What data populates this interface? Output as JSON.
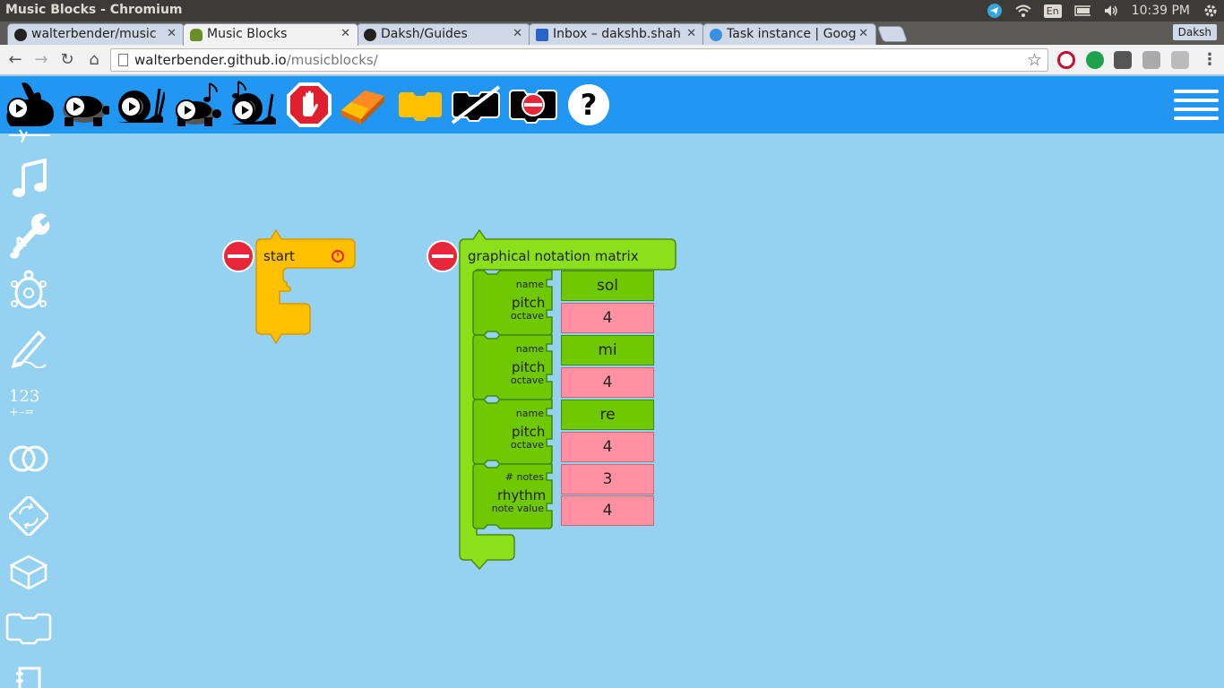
{
  "os": {
    "window_title": "Music Blocks - Chromium",
    "lang": "En",
    "time": "10:39 PM"
  },
  "tabs": [
    {
      "label": "walterbender/music",
      "favicon": "github-icon",
      "active": false
    },
    {
      "label": "Music Blocks",
      "favicon": "turtle-icon",
      "active": true
    },
    {
      "label": "Daksh/Guides",
      "favicon": "github-icon",
      "active": false
    },
    {
      "label": "Inbox – dakshb.shah",
      "favicon": "mail-icon",
      "active": false
    },
    {
      "label": "Task instance | Goog",
      "favicon": "gear-icon",
      "active": false
    }
  ],
  "profile_name": "Daksh",
  "address": {
    "host": "walterbender.github.io",
    "path": "/musicblocks/"
  },
  "toolbar": {
    "buttons": [
      "play-fast-rabbit-button",
      "play-turtle-button",
      "play-snail-button",
      "play-music-turtle-button",
      "play-music-snail-button",
      "stop-button",
      "clear-eraser-button",
      "collapse-blocks-button",
      "hide-blocks-button",
      "collapse-stack-button",
      "help-button"
    ],
    "help_glyph": "?"
  },
  "palette": {
    "number_label": "123",
    "number_ops": "+–="
  },
  "colors": {
    "toolbar": "#2196f3",
    "canvas": "#95d1f0",
    "start_block": "#ffc000",
    "matrix_block": "#8ae01a",
    "pitch_block": "#6fc800",
    "number_block": "#ff91a3",
    "delete": "#e8273a"
  },
  "blocks": {
    "start": {
      "label": "start"
    },
    "matrix": {
      "label": "graphical notation matrix",
      "rows": [
        {
          "type": "pitch",
          "label": "pitch",
          "arg1_label": "name",
          "arg2_label": "octave",
          "arg1_value": "sol",
          "arg2_value": "4"
        },
        {
          "type": "pitch",
          "label": "pitch",
          "arg1_label": "name",
          "arg2_label": "octave",
          "arg1_value": "mi",
          "arg2_value": "4"
        },
        {
          "type": "pitch",
          "label": "pitch",
          "arg1_label": "name",
          "arg2_label": "octave",
          "arg1_value": "re",
          "arg2_value": "4"
        },
        {
          "type": "rhythm",
          "label": "rhythm",
          "arg1_label": "# notes",
          "arg2_label": "note value",
          "arg1_value": "3",
          "arg2_value": "4"
        }
      ]
    }
  }
}
